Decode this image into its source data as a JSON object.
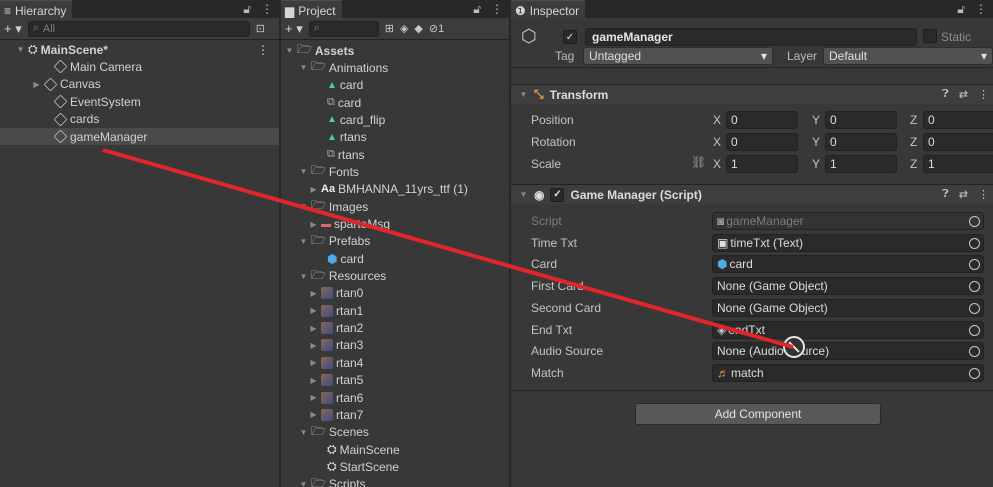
{
  "hierarchy": {
    "tab": "Hierarchy",
    "lock_icon": "lock-icon",
    "search_placeholder": "All",
    "add_label": "+ ▾",
    "items": [
      {
        "label": "MainScene*",
        "kind": "scene"
      },
      {
        "label": "Main Camera",
        "kind": "object"
      },
      {
        "label": "Canvas",
        "kind": "object"
      },
      {
        "label": "EventSystem",
        "kind": "object"
      },
      {
        "label": "cards",
        "kind": "object"
      },
      {
        "label": "gameManager",
        "kind": "object"
      }
    ]
  },
  "project": {
    "tab": "Project",
    "add_label": "+ ▾",
    "hidden_count": "1",
    "items": [
      {
        "label": "Assets",
        "kind": "folder"
      },
      {
        "label": "Animations",
        "kind": "folder"
      },
      {
        "label": "card",
        "kind": "anim"
      },
      {
        "label": "card",
        "kind": "controller"
      },
      {
        "label": "card_flip",
        "kind": "anim"
      },
      {
        "label": "rtans",
        "kind": "anim"
      },
      {
        "label": "rtans",
        "kind": "controller"
      },
      {
        "label": "Fonts",
        "kind": "folder"
      },
      {
        "label": "BMHANNA_11yrs_ttf (1)",
        "kind": "font",
        "prefix": "Aa"
      },
      {
        "label": "Images",
        "kind": "folder"
      },
      {
        "label": "sparteMsg",
        "kind": "sprite"
      },
      {
        "label": "Prefabs",
        "kind": "folder"
      },
      {
        "label": "card",
        "kind": "prefab"
      },
      {
        "label": "Resources",
        "kind": "folder"
      },
      {
        "label": "rtan0",
        "kind": "image"
      },
      {
        "label": "rtan1",
        "kind": "image"
      },
      {
        "label": "rtan2",
        "kind": "image"
      },
      {
        "label": "rtan3",
        "kind": "image"
      },
      {
        "label": "rtan4",
        "kind": "image"
      },
      {
        "label": "rtan5",
        "kind": "image"
      },
      {
        "label": "rtan6",
        "kind": "image"
      },
      {
        "label": "rtan7",
        "kind": "image"
      },
      {
        "label": "Scenes",
        "kind": "folder"
      },
      {
        "label": "MainScene",
        "kind": "scene"
      },
      {
        "label": "StartScene",
        "kind": "scene"
      },
      {
        "label": "Scripts",
        "kind": "folder"
      }
    ]
  },
  "inspector": {
    "tab": "Inspector",
    "object_name": "gameManager",
    "static_label": "Static",
    "tag_label": "Tag",
    "tag_value": "Untagged",
    "layer_label": "Layer",
    "layer_value": "Default",
    "transform": {
      "title": "Transform",
      "rows": [
        {
          "label": "Position",
          "x": "0",
          "y": "0",
          "z": "0"
        },
        {
          "label": "Rotation",
          "x": "0",
          "y": "0",
          "z": "0"
        },
        {
          "label": "Scale",
          "x": "1",
          "y": "1",
          "z": "1"
        }
      ]
    },
    "script_component": {
      "title": "Game Manager (Script)",
      "fields": [
        {
          "label": "Script",
          "value": "gameManager",
          "icon": "script-icon",
          "dim": true
        },
        {
          "label": "Time Txt",
          "value": "timeTxt (Text)",
          "icon": "text-icon"
        },
        {
          "label": "Card",
          "value": "card",
          "icon": "prefab-icon"
        },
        {
          "label": "First Card",
          "value": "None (Game Object)",
          "icon": ""
        },
        {
          "label": "Second Card",
          "value": "None (Game Object)",
          "icon": ""
        },
        {
          "label": "End Txt",
          "value": "endTxt",
          "icon": "object-icon"
        },
        {
          "label": "Audio Source",
          "value": "None (Audio Source)",
          "icon": ""
        },
        {
          "label": "Match",
          "value": "match",
          "icon": "audio-clip-icon"
        }
      ]
    },
    "add_component_label": "Add Component"
  },
  "colors": {
    "panel_bg": "#383838",
    "annotation_line": "#e0262a"
  }
}
